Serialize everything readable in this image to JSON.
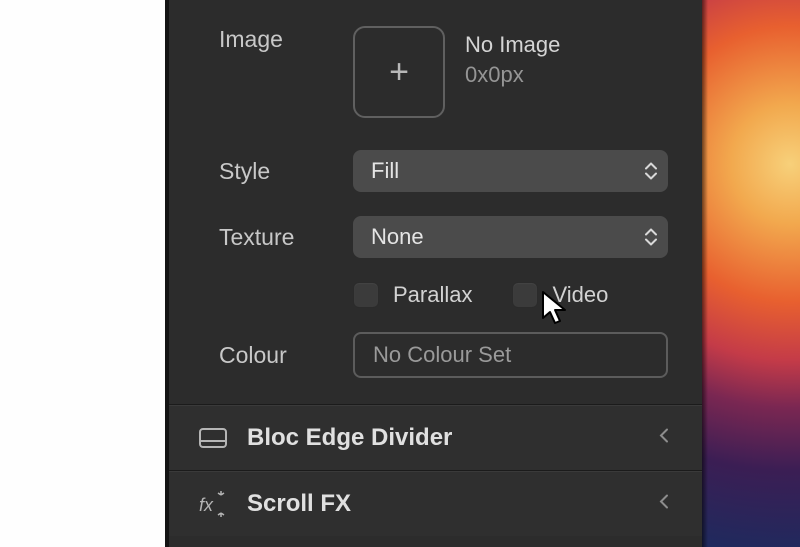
{
  "section": {
    "image": {
      "label": "Image",
      "noImage": "No Image",
      "dimensions": "0x0px"
    },
    "style": {
      "label": "Style",
      "value": "Fill"
    },
    "texture": {
      "label": "Texture",
      "value": "None"
    },
    "parallax": {
      "label": "Parallax",
      "checked": false
    },
    "video": {
      "label": "Video",
      "checked": false
    },
    "colour": {
      "label": "Colour",
      "value": "No Colour Set"
    }
  },
  "accordions": {
    "blocEdgeDivider": "Bloc Edge Divider",
    "scrollFx": "Scroll FX"
  }
}
